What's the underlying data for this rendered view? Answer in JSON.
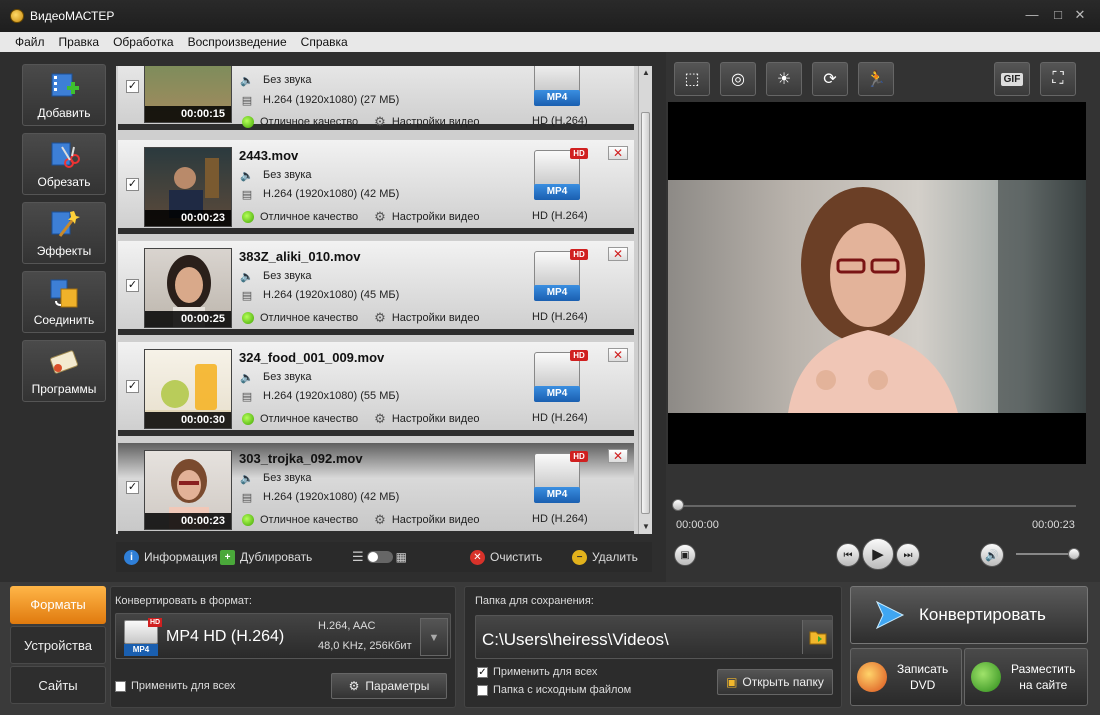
{
  "window": {
    "title": "ВидеоМАСТЕР",
    "minimize": "—",
    "maximize": "□",
    "close": "✕"
  },
  "menu": [
    "Файл",
    "Правка",
    "Обработка",
    "Воспроизведение",
    "Справка"
  ],
  "tools": [
    {
      "label": "Добавить",
      "icon": "add-video-icon"
    },
    {
      "label": "Обрезать",
      "icon": "cut-icon"
    },
    {
      "label": "Эффекты",
      "icon": "effects-icon"
    },
    {
      "label": "Соединить",
      "icon": "join-icon"
    },
    {
      "label": "Программы",
      "icon": "programs-icon"
    }
  ],
  "files": [
    {
      "name": "",
      "audio": "Без звука",
      "video": "H.264 (1920x1080) (27 МБ)",
      "duration": "00:00:15",
      "quality": "Отличное качество",
      "settings": "Настройки видео",
      "format": "HD (H.264)",
      "badge": "MP4",
      "hd": "HD"
    },
    {
      "name": "2443.mov",
      "audio": "Без звука",
      "video": "H.264 (1920x1080) (42 МБ)",
      "duration": "00:00:23",
      "quality": "Отличное качество",
      "settings": "Настройки видео",
      "format": "HD (H.264)",
      "badge": "MP4",
      "hd": "HD"
    },
    {
      "name": "383Z_aliki_010.mov",
      "audio": "Без звука",
      "video": "H.264 (1920x1080) (45 МБ)",
      "duration": "00:00:25",
      "quality": "Отличное качество",
      "settings": "Настройки видео",
      "format": "HD (H.264)",
      "badge": "MP4",
      "hd": "HD"
    },
    {
      "name": "324_food_001_009.mov",
      "audio": "Без звука",
      "video": "H.264 (1920x1080) (55 МБ)",
      "duration": "00:00:30",
      "quality": "Отличное качество",
      "settings": "Настройки видео",
      "format": "HD (H.264)",
      "badge": "MP4",
      "hd": "HD"
    },
    {
      "name": "303_trojka_092.mov",
      "audio": "Без звука",
      "video": "H.264 (1920x1080) (42 МБ)",
      "duration": "00:00:23",
      "quality": "Отличное качество",
      "settings": "Настройки видео",
      "format": "HD (H.264)",
      "badge": "MP4",
      "hd": "HD"
    }
  ],
  "listbar": {
    "info": "Информация",
    "duplicate": "Дублировать",
    "clear": "Очистить",
    "delete": "Удалить"
  },
  "preview": {
    "gif": "GIF",
    "time_start": "00:00:00",
    "time_end": "00:00:23"
  },
  "tabs": [
    "Форматы",
    "Устройства",
    "Сайты"
  ],
  "format_panel": {
    "label": "Конвертировать в формат:",
    "badge": "MP4",
    "hd": "HD",
    "name": "MP4 HD (H.264)",
    "spec1": "H.264, AAC",
    "spec2": "48,0 KHz, 256Кбит",
    "apply_all": "Применить для всех",
    "params": "Параметры"
  },
  "save_panel": {
    "label": "Папка для сохранения:",
    "path": "C:\\Users\\heiress\\Videos\\",
    "apply_all": "Применить для всех",
    "source_folder": "Папка с исходным файлом",
    "open_folder": "Открыть папку"
  },
  "convert": {
    "label": "Конвертировать",
    "dvd_line1": "Записать",
    "dvd_line2": "DVD",
    "site_line1": "Разместить",
    "site_line2": "на сайте"
  }
}
